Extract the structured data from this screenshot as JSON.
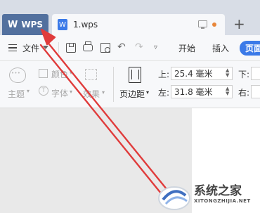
{
  "tabs": {
    "wps_label": "WPS",
    "document_label": "1.wps",
    "new_tab_symbol": "+"
  },
  "menubar": {
    "file_label": "文件",
    "start_label": "开始",
    "insert_label": "插入",
    "active_tab_label": "页面"
  },
  "ribbon": {
    "theme_label": "主题",
    "color_label": "颜色",
    "font_label": "字体",
    "effect_label": "效果",
    "page_margin_label": "页边距",
    "margin_top_label": "上:",
    "margin_top_value": "25.4 毫米",
    "margin_left_label": "左:",
    "margin_left_value": "31.8 毫米",
    "margin_bottom_label": "下:",
    "margin_right_label": "右:"
  },
  "watermark": {
    "site_name": "系统之家",
    "site_url": "XITONGZHIJIA.NET"
  },
  "colors": {
    "wps_tab": "#52709e",
    "active_tab": "#3b7ae8",
    "annotation_arrow": "#e03b3b",
    "unsaved_dot": "#e8873a"
  }
}
